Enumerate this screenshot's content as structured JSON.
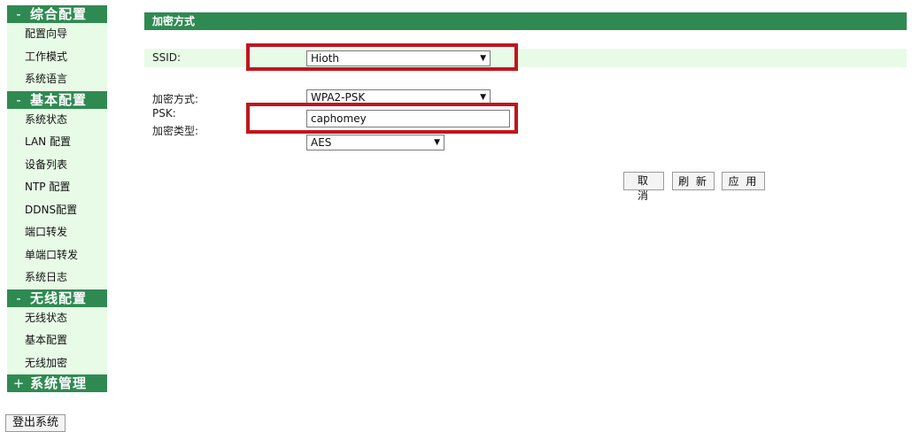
{
  "sidebar": {
    "sections": [
      {
        "toggle": "-",
        "title": "综合配置",
        "items": [
          "配置向导",
          "工作模式",
          "系统语言"
        ]
      },
      {
        "toggle": "-",
        "title": "基本配置",
        "items": [
          "系统状态",
          "LAN 配置",
          "设备列表",
          "NTP 配置",
          "DDNS配置",
          "端口转发",
          "单端口转发",
          "系统日志"
        ]
      },
      {
        "toggle": "-",
        "title": "无线配置",
        "items": [
          "无线状态",
          "基本配置",
          "无线加密"
        ]
      },
      {
        "toggle": "+",
        "title": "系统管理",
        "items": []
      }
    ],
    "logout_label": "登出系统"
  },
  "main": {
    "title": "加密方式",
    "ssid": {
      "label": "SSID:",
      "value": "Hioth"
    },
    "encryption_method": {
      "label": "加密方式:",
      "value": "WPA2-PSK"
    },
    "psk": {
      "label": "PSK:",
      "value": "caphomey"
    },
    "encryption_type": {
      "label": "加密类型:",
      "value": "AES"
    },
    "buttons": {
      "cancel": "取 消",
      "refresh": "刷 新",
      "apply": "应 用"
    }
  },
  "colors": {
    "accent": "#2f8a52",
    "light_bg": "#e7fbe6",
    "highlight": "#c0161d"
  }
}
